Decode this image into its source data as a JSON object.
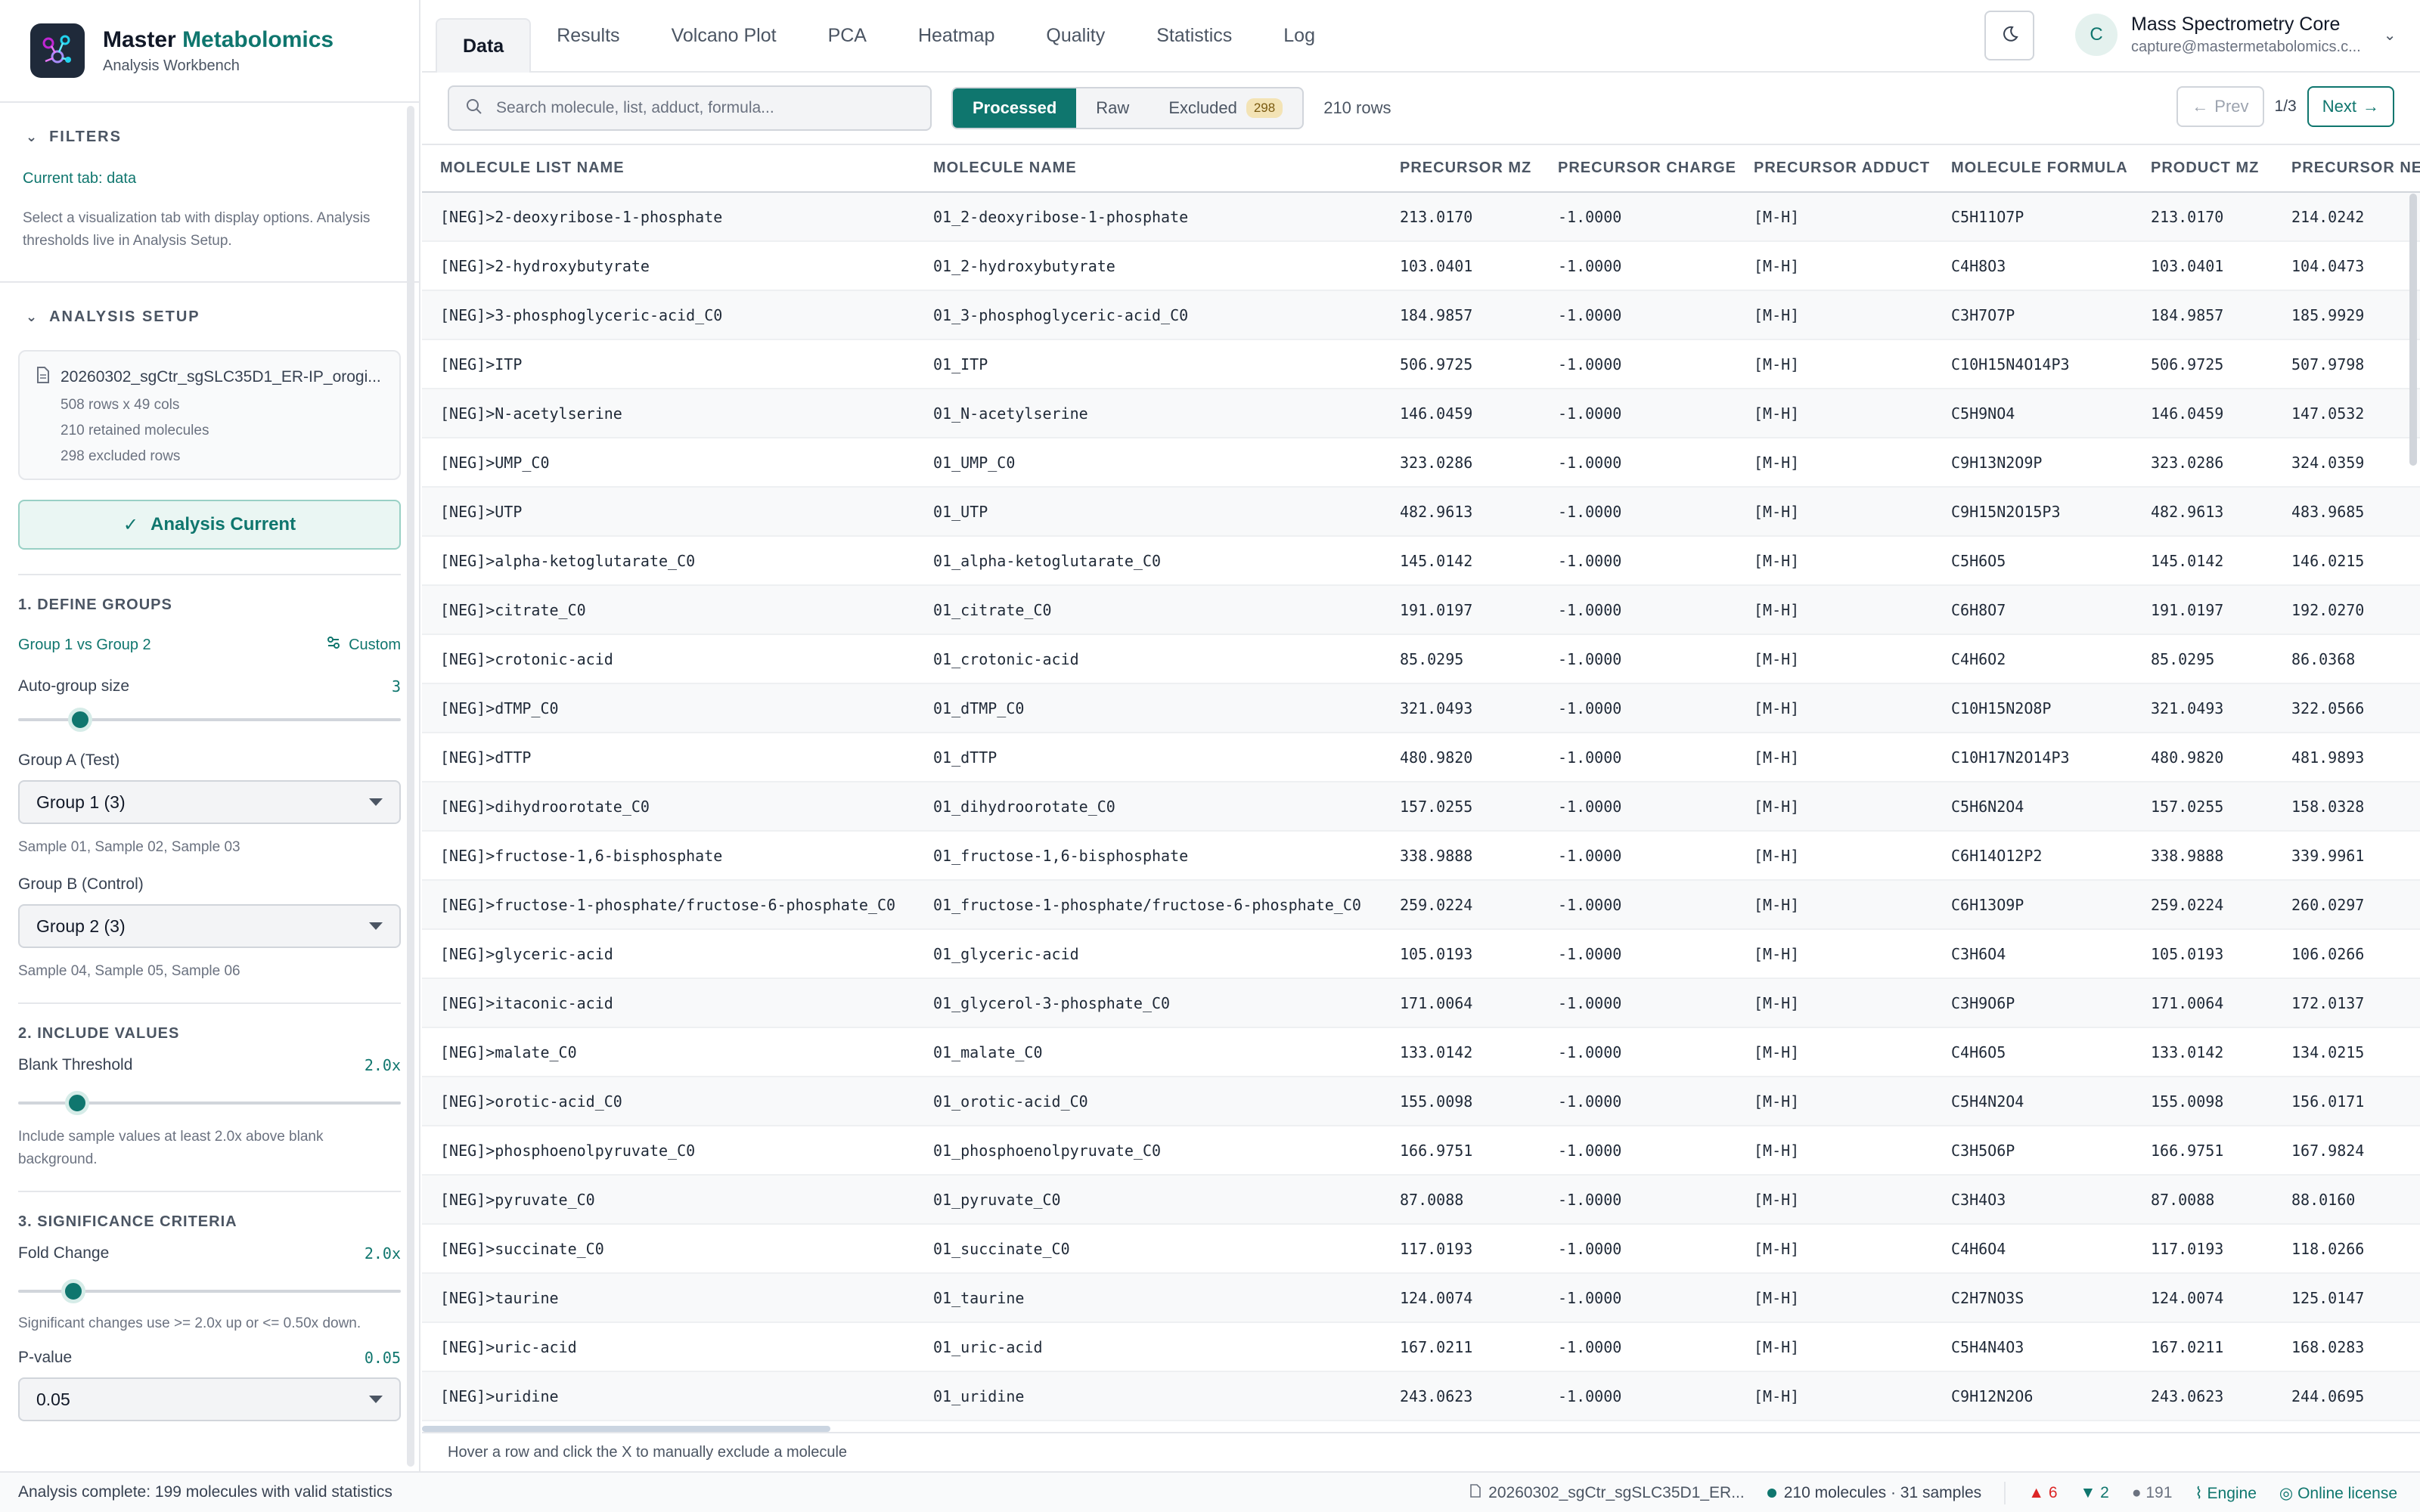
{
  "app": {
    "name_part1": "Master",
    "name_part2": "Metabolomics",
    "subtitle": "Analysis Workbench"
  },
  "tabs": [
    "Data",
    "Results",
    "Volcano Plot",
    "PCA",
    "Heatmap",
    "Quality",
    "Statistics",
    "Log"
  ],
  "active_tab": "Data",
  "account": {
    "initial": "C",
    "name": "Mass Spectrometry Core",
    "email": "capture@mastermetabolomics.c..."
  },
  "sidebar": {
    "filters": {
      "title": "FILTERS",
      "current_tab": "Current tab: data",
      "help": "Select a visualization tab with display options. Analysis thresholds live in Analysis Setup."
    },
    "setup": {
      "title": "ANALYSIS SETUP",
      "file_name": "20260302_sgCtr_sgSLC35D1_ER-IP_orogi...",
      "stats": [
        "508 rows x 49 cols",
        "210 retained molecules",
        "298 excluded rows"
      ],
      "status_button": "Analysis Current"
    },
    "groups": {
      "title": "1. DEFINE GROUPS",
      "comparison": "Group 1 vs Group 2",
      "custom": "Custom",
      "auto_label": "Auto-group size",
      "auto_value": "3",
      "auto_slider_fraction": 0.14,
      "a_label": "Group A (Test)",
      "a_value": "Group 1 (3)",
      "a_samples": "Sample 01, Sample 02, Sample 03",
      "b_label": "Group B (Control)",
      "b_value": "Group 2 (3)",
      "b_samples": "Sample 04, Sample 05, Sample 06"
    },
    "include": {
      "title": "2. INCLUDE VALUES",
      "blank_label": "Blank Threshold",
      "blank_value": "2.0x",
      "blank_slider_fraction": 0.13,
      "blank_note": "Include sample values at least 2.0x above blank background."
    },
    "significance": {
      "title": "3. SIGNIFICANCE CRITERIA",
      "fc_label": "Fold Change",
      "fc_value": "2.0x",
      "fc_slider_fraction": 0.12,
      "fc_note": "Significant changes use >= 2.0x up or <= 0.50x down.",
      "p_label": "P-value",
      "p_value": "0.05",
      "p_select": "0.05"
    }
  },
  "toolbar": {
    "search_placeholder": "Search molecule, list, adduct, formula...",
    "seg_processed": "Processed",
    "seg_raw": "Raw",
    "seg_excluded": "Excluded",
    "excluded_count": "298",
    "row_count": "210 rows",
    "prev": "Prev",
    "page": "1/3",
    "next": "Next"
  },
  "table": {
    "columns": [
      "MOLECULE LIST NAME",
      "MOLECULE NAME",
      "PRECURSOR MZ",
      "PRECURSOR CHARGE",
      "PRECURSOR ADDUCT",
      "MOLECULE FORMULA",
      "PRODUCT MZ",
      "PRECURSOR NEU"
    ],
    "rows": [
      [
        "[NEG]>2-deoxyribose-1-phosphate",
        "01_2-deoxyribose-1-phosphate",
        "213.0170",
        "-1.0000",
        "[M-H]",
        "C5H11O7P",
        "213.0170",
        "214.0242"
      ],
      [
        "[NEG]>2-hydroxybutyrate",
        "01_2-hydroxybutyrate",
        "103.0401",
        "-1.0000",
        "[M-H]",
        "C4H8O3",
        "103.0401",
        "104.0473"
      ],
      [
        "[NEG]>3-phosphoglyceric-acid_C0",
        "01_3-phosphoglyceric-acid_C0",
        "184.9857",
        "-1.0000",
        "[M-H]",
        "C3H7O7P",
        "184.9857",
        "185.9929"
      ],
      [
        "[NEG]>ITP",
        "01_ITP",
        "506.9725",
        "-1.0000",
        "[M-H]",
        "C10H15N4O14P3",
        "506.9725",
        "507.9798"
      ],
      [
        "[NEG]>N-acetylserine",
        "01_N-acetylserine",
        "146.0459",
        "-1.0000",
        "[M-H]",
        "C5H9NO4",
        "146.0459",
        "147.0532"
      ],
      [
        "[NEG]>UMP_C0",
        "01_UMP_C0",
        "323.0286",
        "-1.0000",
        "[M-H]",
        "C9H13N2O9P",
        "323.0286",
        "324.0359"
      ],
      [
        "[NEG]>UTP",
        "01_UTP",
        "482.9613",
        "-1.0000",
        "[M-H]",
        "C9H15N2O15P3",
        "482.9613",
        "483.9685"
      ],
      [
        "[NEG]>alpha-ketoglutarate_C0",
        "01_alpha-ketoglutarate_C0",
        "145.0142",
        "-1.0000",
        "[M-H]",
        "C5H6O5",
        "145.0142",
        "146.0215"
      ],
      [
        "[NEG]>citrate_C0",
        "01_citrate_C0",
        "191.0197",
        "-1.0000",
        "[M-H]",
        "C6H8O7",
        "191.0197",
        "192.0270"
      ],
      [
        "[NEG]>crotonic-acid",
        "01_crotonic-acid",
        "85.0295",
        "-1.0000",
        "[M-H]",
        "C4H6O2",
        "85.0295",
        "86.0368"
      ],
      [
        "[NEG]>dTMP_C0",
        "01_dTMP_C0",
        "321.0493",
        "-1.0000",
        "[M-H]",
        "C10H15N2O8P",
        "321.0493",
        "322.0566"
      ],
      [
        "[NEG]>dTTP",
        "01_dTTP",
        "480.9820",
        "-1.0000",
        "[M-H]",
        "C10H17N2O14P3",
        "480.9820",
        "481.9893"
      ],
      [
        "[NEG]>dihydroorotate_C0",
        "01_dihydroorotate_C0",
        "157.0255",
        "-1.0000",
        "[M-H]",
        "C5H6N2O4",
        "157.0255",
        "158.0328"
      ],
      [
        "[NEG]>fructose-1,6-bisphosphate",
        "01_fructose-1,6-bisphosphate",
        "338.9888",
        "-1.0000",
        "[M-H]",
        "C6H14O12P2",
        "338.9888",
        "339.9961"
      ],
      [
        "[NEG]>fructose-1-phosphate/fructose-6-phosphate_C0",
        "01_fructose-1-phosphate/fructose-6-phosphate_C0",
        "259.0224",
        "-1.0000",
        "[M-H]",
        "C6H13O9P",
        "259.0224",
        "260.0297"
      ],
      [
        "[NEG]>glyceric-acid",
        "01_glyceric-acid",
        "105.0193",
        "-1.0000",
        "[M-H]",
        "C3H6O4",
        "105.0193",
        "106.0266"
      ],
      [
        "[NEG]>itaconic-acid",
        "01_glycerol-3-phosphate_C0",
        "171.0064",
        "-1.0000",
        "[M-H]",
        "C3H9O6P",
        "171.0064",
        "172.0137"
      ],
      [
        "[NEG]>malate_C0",
        "01_malate_C0",
        "133.0142",
        "-1.0000",
        "[M-H]",
        "C4H6O5",
        "133.0142",
        "134.0215"
      ],
      [
        "[NEG]>orotic-acid_C0",
        "01_orotic-acid_C0",
        "155.0098",
        "-1.0000",
        "[M-H]",
        "C5H4N2O4",
        "155.0098",
        "156.0171"
      ],
      [
        "[NEG]>phosphoenolpyruvate_C0",
        "01_phosphoenolpyruvate_C0",
        "166.9751",
        "-1.0000",
        "[M-H]",
        "C3H5O6P",
        "166.9751",
        "167.9824"
      ],
      [
        "[NEG]>pyruvate_C0",
        "01_pyruvate_C0",
        "87.0088",
        "-1.0000",
        "[M-H]",
        "C3H4O3",
        "87.0088",
        "88.0160"
      ],
      [
        "[NEG]>succinate_C0",
        "01_succinate_C0",
        "117.0193",
        "-1.0000",
        "[M-H]",
        "C4H6O4",
        "117.0193",
        "118.0266"
      ],
      [
        "[NEG]>taurine",
        "01_taurine",
        "124.0074",
        "-1.0000",
        "[M-H]",
        "C2H7NO3S",
        "124.0074",
        "125.0147"
      ],
      [
        "[NEG]>uric-acid",
        "01_uric-acid",
        "167.0211",
        "-1.0000",
        "[M-H]",
        "C5H4N4O3",
        "167.0211",
        "168.0283"
      ],
      [
        "[NEG]>uridine",
        "01_uridine",
        "243.0623",
        "-1.0000",
        "[M-H]",
        "C9H12N2O6",
        "243.0623",
        "244.0695"
      ]
    ],
    "hover_hint": "Hover a row and click the X to manually exclude a molecule"
  },
  "status": {
    "left": "Analysis complete: 199 molecules with valid statistics",
    "file": "20260302_sgCtr_sgSLC35D1_ER...",
    "summary": "210 molecules · 31 samples",
    "up": "6",
    "down": "2",
    "neutral": "191",
    "engine": "Engine",
    "license": "Online license"
  },
  "colors": {
    "accent": "#0f766e",
    "up": "#dc2626",
    "badge": "#f3e3b5"
  }
}
